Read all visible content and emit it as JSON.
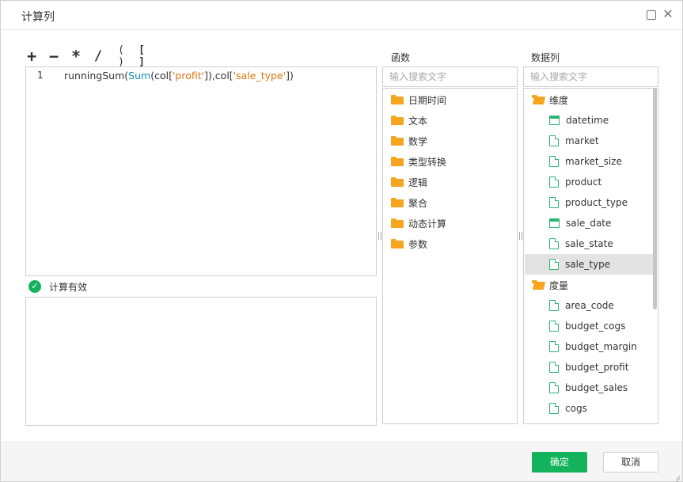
{
  "dialog": {
    "title": "计算列"
  },
  "operators": [
    "+",
    "−",
    "*",
    "/",
    "( )",
    "[ ]"
  ],
  "editor": {
    "line_number": "1",
    "code_tokens": {
      "fn": "runningSum",
      "open1": "(",
      "sum": "Sum",
      "open2": "(col[",
      "str1": "'profit'",
      "mid": "]),col[",
      "str2": "'sale_type'",
      "close": "])"
    }
  },
  "validation": {
    "status": "计算有效",
    "icon": "check-circle-icon",
    "color": "#14b25f"
  },
  "functions_panel": {
    "label": "函数",
    "search_placeholder": "输入搜索文字",
    "folders": [
      "日期时间",
      "文本",
      "数学",
      "类型转换",
      "逻辑",
      "聚合",
      "动态计算",
      "参数"
    ]
  },
  "columns_panel": {
    "label": "数据列",
    "search_placeholder": "输入搜索文字",
    "dimensions_label": "维度",
    "dimensions": [
      {
        "name": "datetime",
        "icon": "date-icon"
      },
      {
        "name": "market",
        "icon": "file-icon"
      },
      {
        "name": "market_size",
        "icon": "file-icon"
      },
      {
        "name": "product",
        "icon": "file-icon"
      },
      {
        "name": "product_type",
        "icon": "file-icon"
      },
      {
        "name": "sale_date",
        "icon": "date-icon"
      },
      {
        "name": "sale_state",
        "icon": "file-icon"
      },
      {
        "name": "sale_type",
        "icon": "file-icon",
        "selected": true
      }
    ],
    "measures_label": "度量",
    "measures": [
      {
        "name": "area_code",
        "icon": "file-icon"
      },
      {
        "name": "budget_cogs",
        "icon": "file-icon"
      },
      {
        "name": "budget_margin",
        "icon": "file-icon"
      },
      {
        "name": "budget_profit",
        "icon": "file-icon"
      },
      {
        "name": "budget_sales",
        "icon": "file-icon"
      },
      {
        "name": "cogs",
        "icon": "file-icon"
      }
    ]
  },
  "footer": {
    "ok_label": "确定",
    "cancel_label": "取消"
  },
  "colors": {
    "accent": "#13b35c",
    "folder": "#f7a51e",
    "code_blue": "#1a8fb5",
    "code_string": "#e0740f"
  }
}
